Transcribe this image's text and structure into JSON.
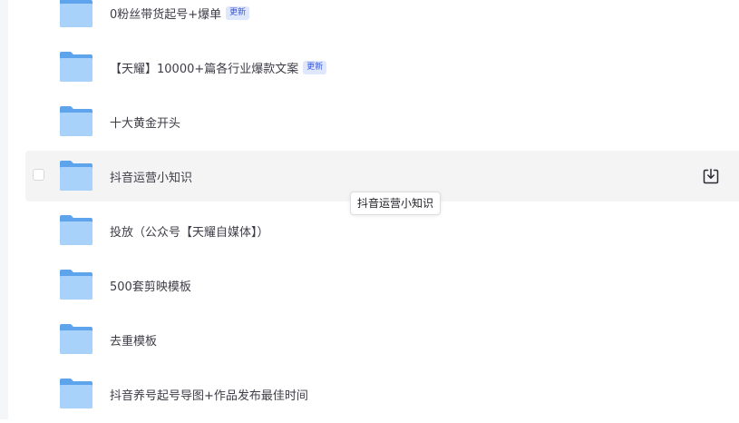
{
  "files": [
    {
      "name": "0粉丝带货起号+爆单",
      "badge": "更新"
    },
    {
      "name": "【天耀】10000+篇各行业爆款文案",
      "badge": "更新"
    },
    {
      "name": "十大黄金开头"
    },
    {
      "name": "抖音运营小知识",
      "hovered": true
    },
    {
      "name": "投放（公众号【天耀自媒体】）"
    },
    {
      "name": "500套剪映模板"
    },
    {
      "name": "去重模板"
    },
    {
      "name": "抖音养号起号导图+作品发布最佳时间"
    }
  ],
  "tooltip": {
    "text": "抖音运营小知识"
  },
  "icons": {
    "folder": "folder-icon",
    "download": "download-icon",
    "checkbox": "checkbox"
  },
  "colors": {
    "folder_back": "#5ea4ec",
    "folder_front": "#a9d2fb",
    "badge_text": "#3b5bdb",
    "badge_bg": "#dfe7fd",
    "hover_row": "#f4f4f5"
  }
}
